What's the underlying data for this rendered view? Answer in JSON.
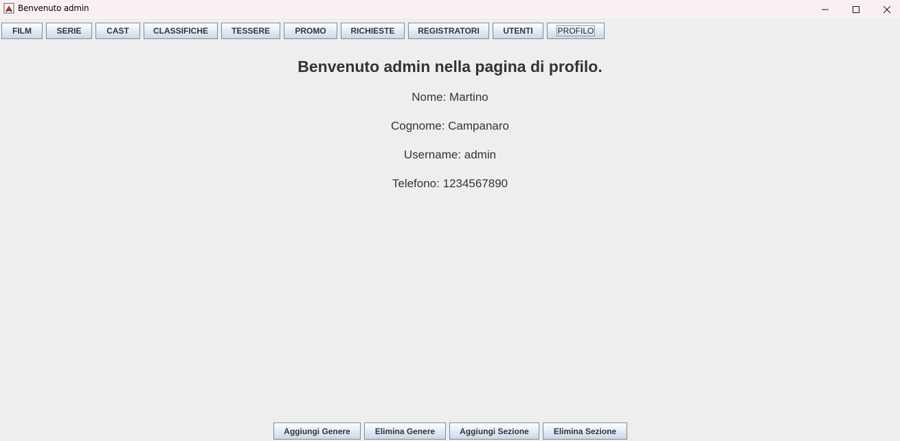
{
  "window": {
    "title": "Benvenuto admin",
    "icons": [
      "java-app-icon",
      "minimize-icon",
      "maximize-icon",
      "close-icon"
    ]
  },
  "nav": {
    "items": [
      {
        "label": "FILM"
      },
      {
        "label": "SERIE"
      },
      {
        "label": "CAST"
      },
      {
        "label": "CLASSIFICHE"
      },
      {
        "label": "TESSERE"
      },
      {
        "label": "PROMO"
      },
      {
        "label": "RICHIESTE"
      },
      {
        "label": "REGISTRATORI"
      },
      {
        "label": "UTENTI"
      },
      {
        "label": "PROFILO"
      }
    ],
    "focused": "PROFILO"
  },
  "profile": {
    "heading": "Benvenuto admin nella pagina di profilo.",
    "nome": "Nome: Martino",
    "cognome": "Cognome: Campanaro",
    "username": "Username: admin",
    "telefono": "Telefono: 1234567890"
  },
  "actions": {
    "add_genre": "Aggiungi Genere",
    "delete_genre": "Elimina Genere",
    "add_section": "Aggiungi Sezione",
    "delete_section": "Elimina Sezione"
  },
  "colors": {
    "background": "#eeeeee",
    "titlebar": "#f9f1f1",
    "text": "#333333",
    "button_border": "#7a8a99"
  }
}
